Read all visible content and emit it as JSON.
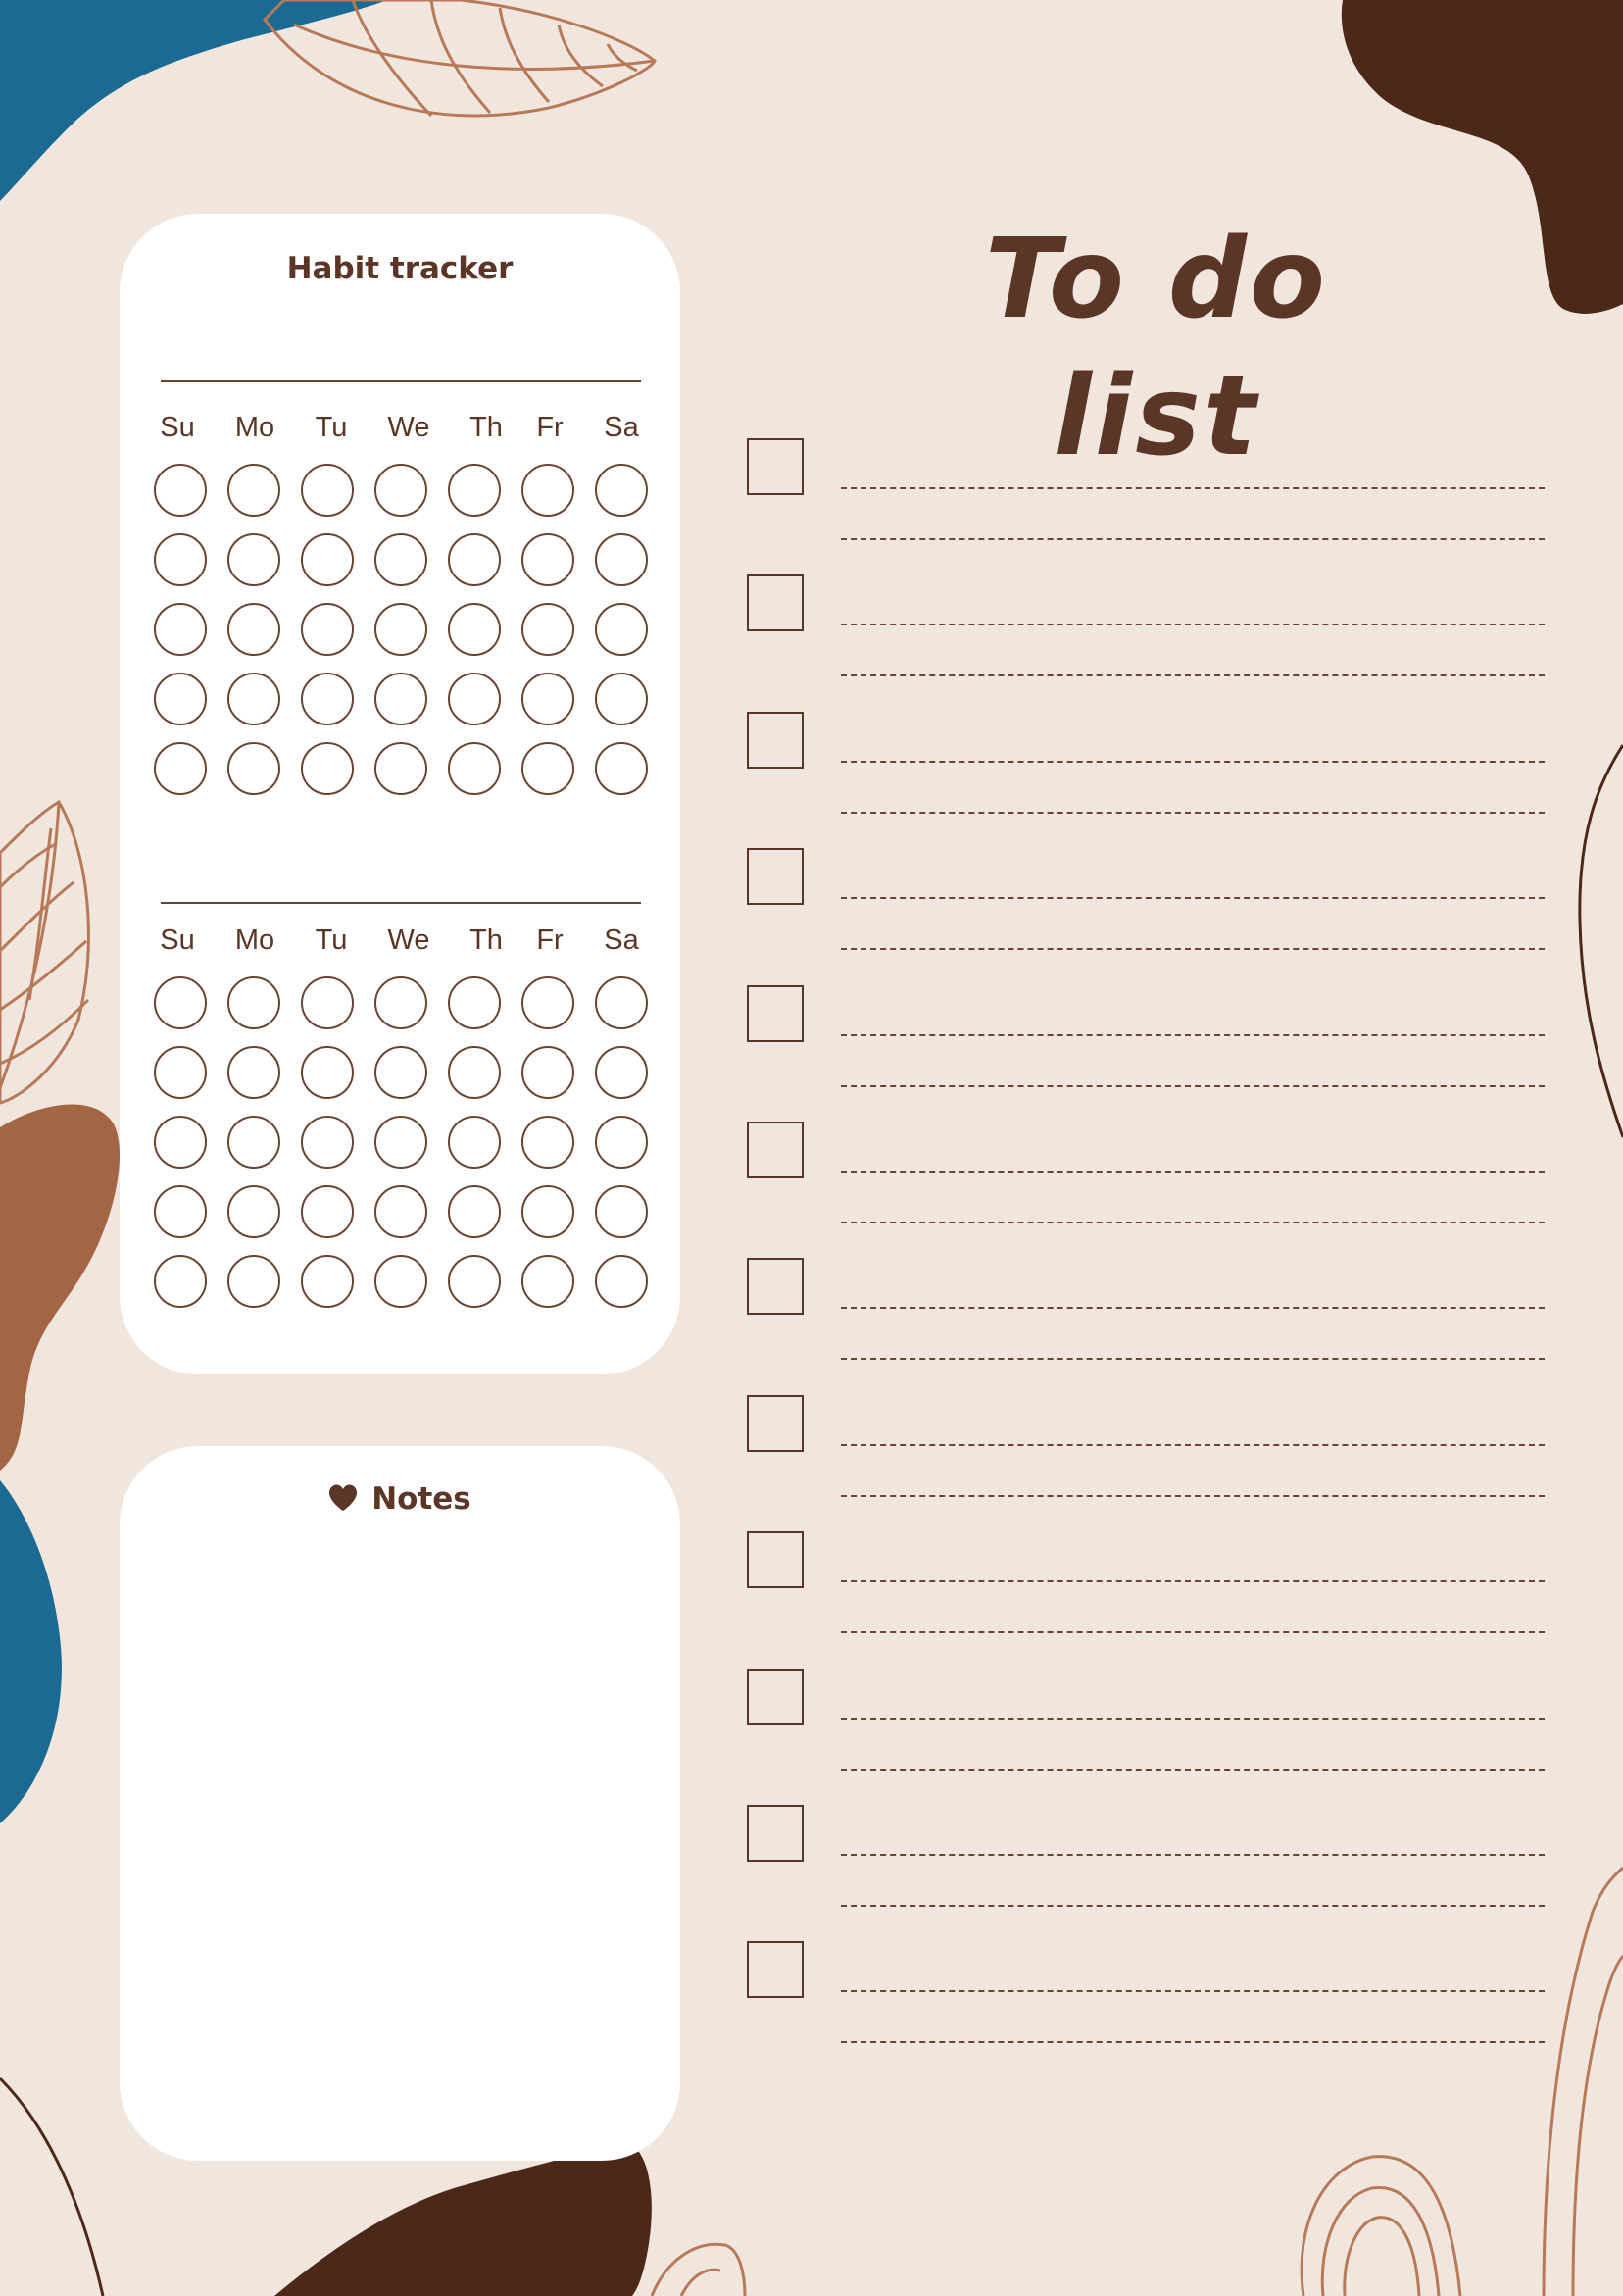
{
  "colors": {
    "background": "#f1e6dd",
    "card": "#ffffff",
    "text": "#5b3525",
    "blue": "#1b6a94",
    "dark_brown": "#4c2818",
    "rust": "#a36543",
    "line_art": "#b77a58"
  },
  "habit_tracker": {
    "title": "Habit tracker",
    "weeks": [
      {
        "days": [
          "Su",
          "Mo",
          "Tu",
          "We",
          "Th",
          "Fr",
          "Sa"
        ],
        "rows": 5
      },
      {
        "days": [
          "Su",
          "Mo",
          "Tu",
          "We",
          "Th",
          "Fr",
          "Sa"
        ],
        "rows": 5
      }
    ]
  },
  "notes": {
    "title": "Notes",
    "icon": "heart-icon"
  },
  "todo": {
    "title": "To do list",
    "item_count": 12,
    "lines_per_item": 2
  }
}
